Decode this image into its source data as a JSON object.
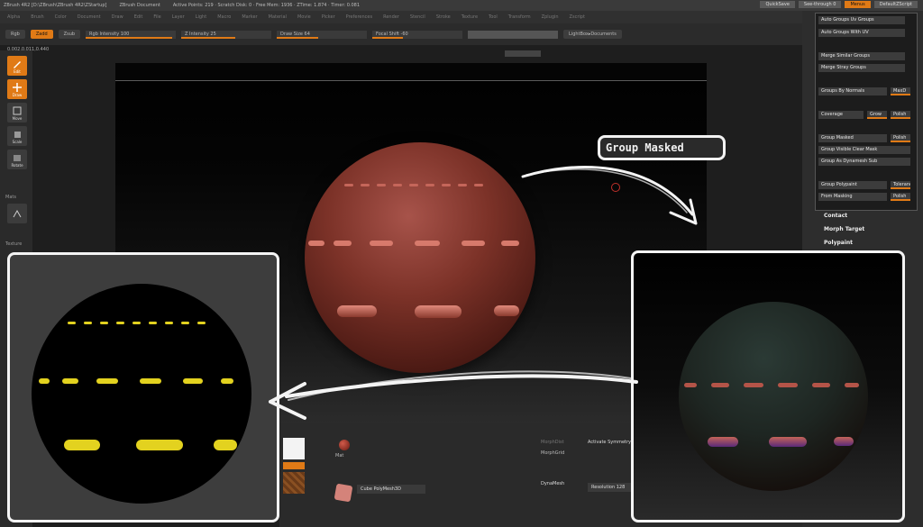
{
  "titlebar": {
    "app": "ZBrush 4R2 [D:\\ZBrush\\ZBrush 4R2\\ZStartup]",
    "doc": "ZBrush Document",
    "stats": "Active Points: 219 · Scratch Disk: 0 · Free Mem: 1936 · ZTime: 1.874 · Timer: 0.081",
    "buttons": [
      "QuickSave",
      "See-through 0",
      "Menus",
      "DefaultZScript"
    ]
  },
  "menubar": [
    "Alpha",
    "Brush",
    "Color",
    "Document",
    "Draw",
    "Edit",
    "File",
    "Layer",
    "Light",
    "Macro",
    "Marker",
    "Material",
    "Movie",
    "Picker",
    "Preferences",
    "Render",
    "Stencil",
    "Stroke",
    "Texture",
    "Tool",
    "Transform",
    "Zplugin",
    "Zscript"
  ],
  "toolstrip": {
    "rgb": "Rgb",
    "zadd": "Zadd",
    "zsub": "Zsub",
    "rgb_intensity": "Rgb Intensity 100",
    "z_intensity": "Z Intensity 25",
    "draw_size": "Draw Size 64",
    "focal_shift": "Focal Shift -60",
    "lightbox": "LightBox▸Documents"
  },
  "coord_readout": "0.002,0.011,0.440",
  "shelf": {
    "edit": "Edit",
    "draw": "Draw",
    "move": "Move",
    "scale": "Scale",
    "rotate": "Rotate",
    "persp": "Persp",
    "section_label": "Mats",
    "texture_label": "Texture"
  },
  "callout": "Group Masked",
  "right_panel": {
    "buttons": [
      "Auto Groups Uv Groups",
      "Auto Groups With UV",
      "Merge Similar Groups",
      "Merge Stray Groups",
      "Groups By Normals",
      "Coverage",
      "Grow",
      "Group Masked",
      "Group Visible Clear Mask",
      "Group As Dynamesh Sub",
      "Group Polypaint",
      "From Masking"
    ],
    "side_buttons": [
      "MaxD",
      "Polish",
      "Polish",
      "Tolerance",
      "Polish"
    ],
    "sections": [
      "Contact",
      "Morph Target",
      "Polypaint"
    ]
  },
  "bottom": {
    "material_label": "Mat",
    "brush_label": "Cube PolyMesh3D",
    "morph_dist": "MorphDist",
    "activate_sym": "Activate Symmetry",
    "morph_grid": "MorphGrid",
    "dynamesh": "DynaMesh",
    "resolution": "Resolution 128"
  },
  "colors": {
    "accent": "#e07a16",
    "sphere_base": "#7c3228",
    "mask_yellow": "#e3d21f",
    "panel": "#2d2d2d",
    "callout_border": "#f2f2f2"
  },
  "icons": [
    "edit-icon",
    "move-icon",
    "scale-icon",
    "rotate-icon",
    "persp-icon",
    "material-sphere-icon",
    "cube-icon",
    "arrow-icon"
  ]
}
